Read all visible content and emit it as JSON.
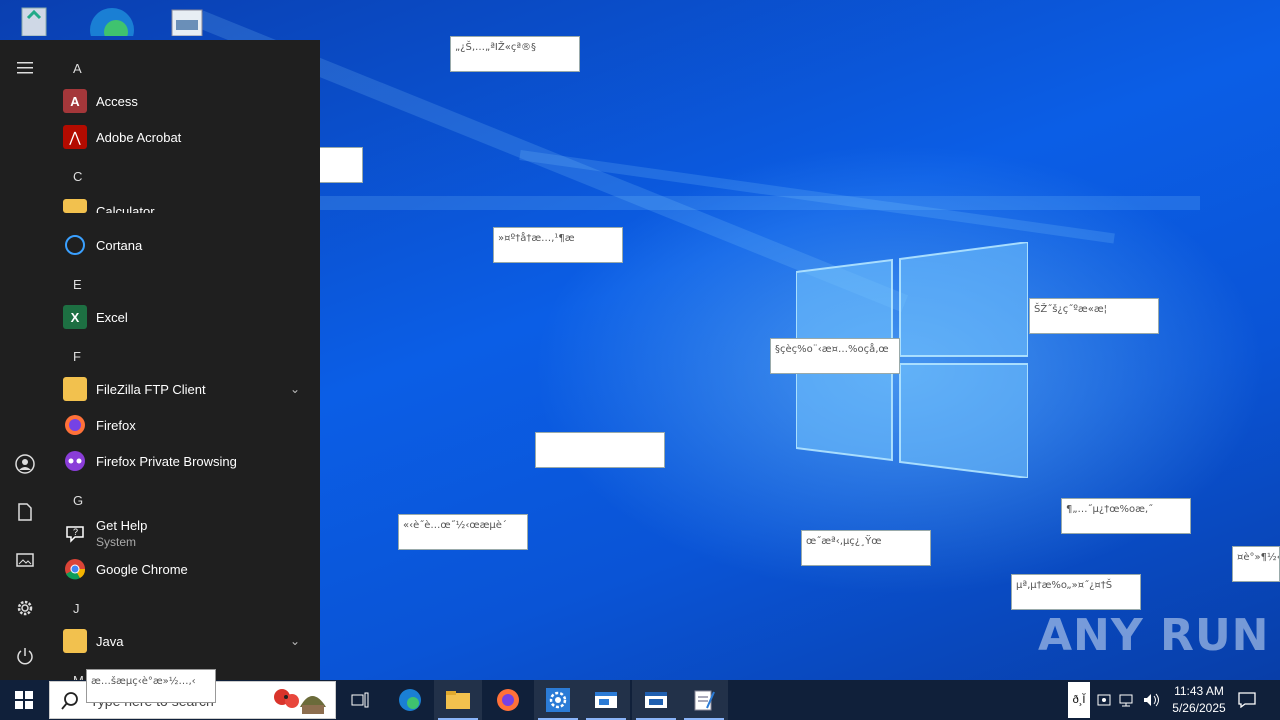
{
  "start_menu": {
    "letters": {
      "a": "A",
      "c": "C",
      "e": "E",
      "f": "F",
      "g": "G",
      "j": "J",
      "m": "M"
    },
    "apps": {
      "access": "Access",
      "acrobat": "Adobe Acrobat",
      "calculator": "Calculator",
      "cortana": "Cortana",
      "excel": "Excel",
      "filezilla": "FileZilla FTP Client",
      "firefox": "Firefox",
      "firefox_private": "Firefox Private Browsing",
      "gethelp": "Get Help",
      "gethelp_sub": "System",
      "chrome": "Google Chrome",
      "java": "Java"
    }
  },
  "popups": {
    "p1": "„¿Š‚…„ªIŽ«çª®§",
    "p2": "",
    "p3": "»¤º†å†æ…‚¹¶æ",
    "p4": "ŠŽ˝š¿ç˝ºæ«æ¦",
    "p5": "§çèç%o¨‹æ¤…%oçå‚œ",
    "p6": "",
    "p7": "«‹è˝è…œ˝½‹œæµè´",
    "p8": "œ˝æª‹‚µç¿¸Ÿœ",
    "p9": "¶„…˝µ¿†œ%oæ‚˝",
    "p10": "µª‚µ†æ%o„»¤˝¿¤†Š",
    "p11": "¤è°»¶½‹",
    "search_popup": "æ…šæµç‹è°æ»½…‚‹"
  },
  "watermark": "ANY RUN",
  "taskbar": {
    "search_placeholder": "Type here to search",
    "time": "11:43 AM",
    "date": "5/26/2025",
    "lang": "ð¸Ĭ"
  },
  "colors": {
    "accent": "#8ab4f8",
    "desktop": "#0b5ee6",
    "menu_bg": "#1f1f1f"
  }
}
